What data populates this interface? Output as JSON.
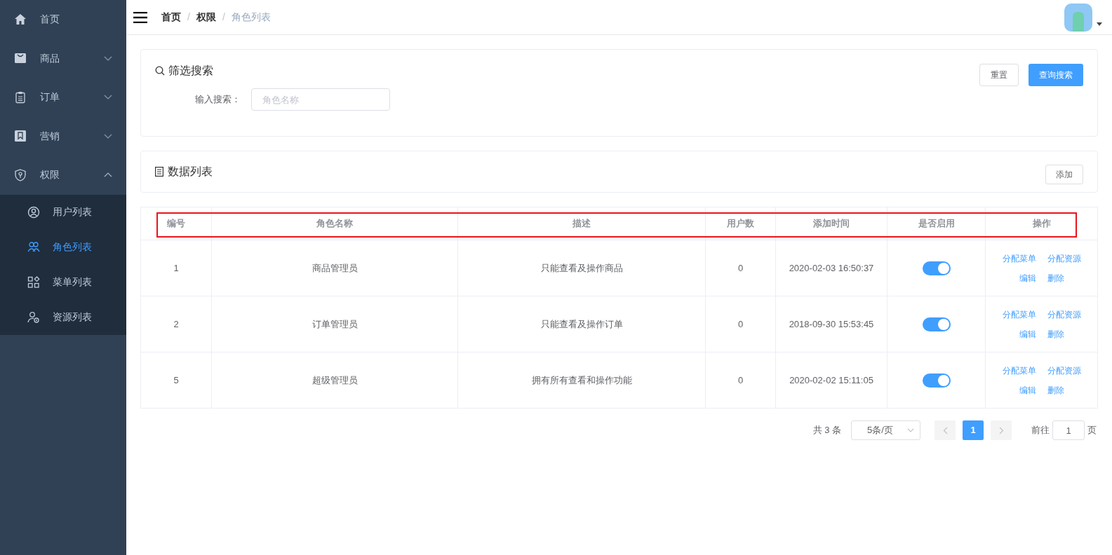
{
  "sidebar": {
    "items": [
      {
        "label": "首页"
      },
      {
        "label": "商品",
        "expanded": false
      },
      {
        "label": "订单",
        "expanded": false
      },
      {
        "label": "营销",
        "expanded": false
      },
      {
        "label": "权限",
        "expanded": true,
        "children": [
          {
            "label": "用户列表",
            "selected": false
          },
          {
            "label": "角色列表",
            "selected": true
          },
          {
            "label": "菜单列表",
            "selected": false
          },
          {
            "label": "资源列表",
            "selected": false
          }
        ]
      }
    ]
  },
  "breadcrumb": [
    {
      "kind": "link",
      "label": "首页"
    },
    {
      "kind": "separator",
      "label": "/"
    },
    {
      "kind": "link",
      "label": "权限"
    },
    {
      "kind": "separator",
      "label": "/"
    },
    {
      "kind": "current",
      "label": "角色列表"
    }
  ],
  "filter": {
    "title": "筛选搜索",
    "field_label": "输入搜索：",
    "placeholder": "角色名称",
    "buttons": [
      {
        "label": "重置",
        "primary": false
      },
      {
        "label": "查询搜索",
        "primary": true
      }
    ]
  },
  "list_header": {
    "title": "数据列表",
    "button": "添加"
  },
  "table": {
    "header_highlighted": true,
    "columns": [
      "编号",
      "角色名称",
      "描述",
      "用户数",
      "添加时间",
      "是否启用",
      "操作"
    ],
    "rows": [
      {
        "cells": [
          "1",
          "商品管理员",
          "只能查看及操作商品",
          "0",
          "2020-02-03 16:50:37"
        ],
        "enabled": true,
        "actions": [
          "分配菜单",
          "分配资源",
          "编辑",
          "删除"
        ]
      },
      {
        "cells": [
          "2",
          "订单管理员",
          "只能查看及操作订单",
          "0",
          "2018-09-30 15:53:45"
        ],
        "enabled": true,
        "actions": [
          "分配菜单",
          "分配资源",
          "编辑",
          "删除"
        ]
      },
      {
        "cells": [
          "5",
          "超级管理员",
          "拥有所有查看和操作功能",
          "0",
          "2020-02-02 15:11:05"
        ],
        "enabled": true,
        "actions": [
          "分配菜单",
          "分配资源",
          "编辑",
          "删除"
        ]
      }
    ]
  },
  "pagination": {
    "total": "共 3 条",
    "page_size": "5条/页",
    "pages": [
      {
        "label": "1",
        "selected": true
      }
    ],
    "goto_label": "前往",
    "goto_value": "1",
    "goto_suffix": "页"
  }
}
